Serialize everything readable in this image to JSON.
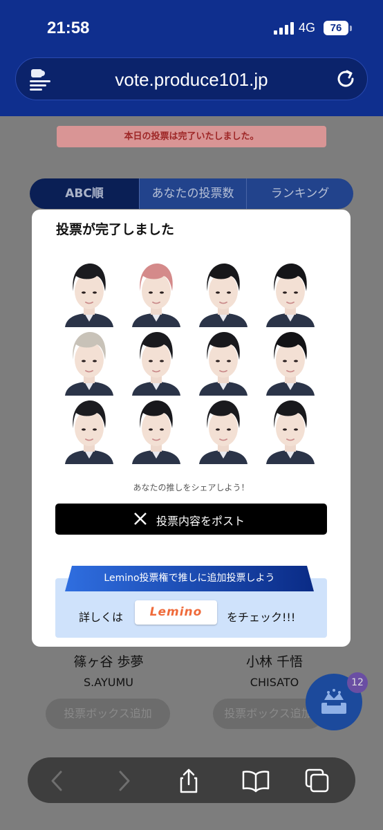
{
  "status_bar": {
    "time": "21:58",
    "network": "4G",
    "battery": "76"
  },
  "browser": {
    "url": "vote.produce101.jp"
  },
  "page": {
    "notice": "本日の投票は完了いたしました。",
    "tabs": [
      {
        "label": "ABC順",
        "active": true
      },
      {
        "label": "あなたの投票数",
        "active": false
      },
      {
        "label": "ランキング",
        "active": false
      }
    ],
    "members": [
      {
        "name_jp": "篠ヶ谷 歩夢",
        "name_en": "S.AYUMU",
        "button": "投票ボックス追加"
      },
      {
        "name_jp": "小林 千悟",
        "name_en": "CHISATO",
        "button": "投票ボックス追加"
      }
    ],
    "fab_badge": "12"
  },
  "modal": {
    "title": "投票が完了しました",
    "faces": [
      {
        "hair": "#1b1b1f"
      },
      {
        "hair": "#d48a8a"
      },
      {
        "hair": "#17171a"
      },
      {
        "hair": "#151518"
      },
      {
        "hair": "#c8c2b8"
      },
      {
        "hair": "#1a1a1e"
      },
      {
        "hair": "#19191d"
      },
      {
        "hair": "#131316"
      },
      {
        "hair": "#1c1c20"
      },
      {
        "hair": "#18181c"
      },
      {
        "hair": "#1a1a1e"
      },
      {
        "hair": "#19191c"
      }
    ],
    "share_prompt": "あなたの推しをシェアしよう！",
    "post_button": "投票内容をポスト",
    "lemino_banner": "Lemino投票権で推しに追加投票しよう",
    "lemino_detail": "詳しくは",
    "lemino_logo": "Lemino",
    "lemino_check": "をチェック!!!"
  },
  "colors": {
    "header": "#0f2f8e",
    "accent": "#1c4a9c",
    "lemino": "#ef6a3a"
  }
}
